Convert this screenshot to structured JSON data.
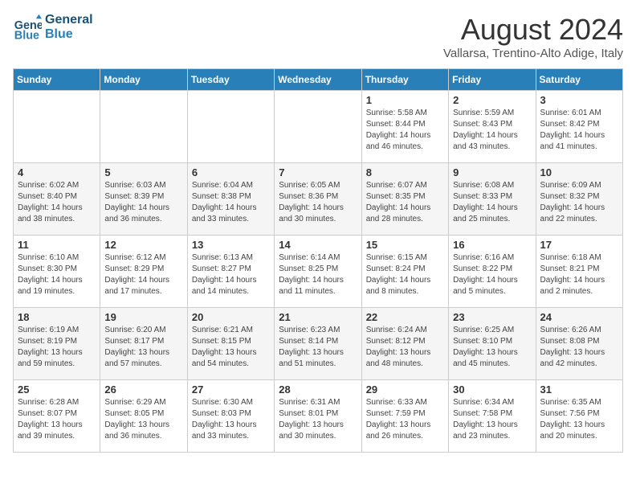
{
  "logo": {
    "line1": "General",
    "line2": "Blue"
  },
  "title": "August 2024",
  "location": "Vallarsa, Trentino-Alto Adige, Italy",
  "headers": [
    "Sunday",
    "Monday",
    "Tuesday",
    "Wednesday",
    "Thursday",
    "Friday",
    "Saturday"
  ],
  "weeks": [
    [
      {
        "day": "",
        "info": ""
      },
      {
        "day": "",
        "info": ""
      },
      {
        "day": "",
        "info": ""
      },
      {
        "day": "",
        "info": ""
      },
      {
        "day": "1",
        "info": "Sunrise: 5:58 AM\nSunset: 8:44 PM\nDaylight: 14 hours\nand 46 minutes."
      },
      {
        "day": "2",
        "info": "Sunrise: 5:59 AM\nSunset: 8:43 PM\nDaylight: 14 hours\nand 43 minutes."
      },
      {
        "day": "3",
        "info": "Sunrise: 6:01 AM\nSunset: 8:42 PM\nDaylight: 14 hours\nand 41 minutes."
      }
    ],
    [
      {
        "day": "4",
        "info": "Sunrise: 6:02 AM\nSunset: 8:40 PM\nDaylight: 14 hours\nand 38 minutes."
      },
      {
        "day": "5",
        "info": "Sunrise: 6:03 AM\nSunset: 8:39 PM\nDaylight: 14 hours\nand 36 minutes."
      },
      {
        "day": "6",
        "info": "Sunrise: 6:04 AM\nSunset: 8:38 PM\nDaylight: 14 hours\nand 33 minutes."
      },
      {
        "day": "7",
        "info": "Sunrise: 6:05 AM\nSunset: 8:36 PM\nDaylight: 14 hours\nand 30 minutes."
      },
      {
        "day": "8",
        "info": "Sunrise: 6:07 AM\nSunset: 8:35 PM\nDaylight: 14 hours\nand 28 minutes."
      },
      {
        "day": "9",
        "info": "Sunrise: 6:08 AM\nSunset: 8:33 PM\nDaylight: 14 hours\nand 25 minutes."
      },
      {
        "day": "10",
        "info": "Sunrise: 6:09 AM\nSunset: 8:32 PM\nDaylight: 14 hours\nand 22 minutes."
      }
    ],
    [
      {
        "day": "11",
        "info": "Sunrise: 6:10 AM\nSunset: 8:30 PM\nDaylight: 14 hours\nand 19 minutes."
      },
      {
        "day": "12",
        "info": "Sunrise: 6:12 AM\nSunset: 8:29 PM\nDaylight: 14 hours\nand 17 minutes."
      },
      {
        "day": "13",
        "info": "Sunrise: 6:13 AM\nSunset: 8:27 PM\nDaylight: 14 hours\nand 14 minutes."
      },
      {
        "day": "14",
        "info": "Sunrise: 6:14 AM\nSunset: 8:25 PM\nDaylight: 14 hours\nand 11 minutes."
      },
      {
        "day": "15",
        "info": "Sunrise: 6:15 AM\nSunset: 8:24 PM\nDaylight: 14 hours\nand 8 minutes."
      },
      {
        "day": "16",
        "info": "Sunrise: 6:16 AM\nSunset: 8:22 PM\nDaylight: 14 hours\nand 5 minutes."
      },
      {
        "day": "17",
        "info": "Sunrise: 6:18 AM\nSunset: 8:21 PM\nDaylight: 14 hours\nand 2 minutes."
      }
    ],
    [
      {
        "day": "18",
        "info": "Sunrise: 6:19 AM\nSunset: 8:19 PM\nDaylight: 13 hours\nand 59 minutes."
      },
      {
        "day": "19",
        "info": "Sunrise: 6:20 AM\nSunset: 8:17 PM\nDaylight: 13 hours\nand 57 minutes."
      },
      {
        "day": "20",
        "info": "Sunrise: 6:21 AM\nSunset: 8:15 PM\nDaylight: 13 hours\nand 54 minutes."
      },
      {
        "day": "21",
        "info": "Sunrise: 6:23 AM\nSunset: 8:14 PM\nDaylight: 13 hours\nand 51 minutes."
      },
      {
        "day": "22",
        "info": "Sunrise: 6:24 AM\nSunset: 8:12 PM\nDaylight: 13 hours\nand 48 minutes."
      },
      {
        "day": "23",
        "info": "Sunrise: 6:25 AM\nSunset: 8:10 PM\nDaylight: 13 hours\nand 45 minutes."
      },
      {
        "day": "24",
        "info": "Sunrise: 6:26 AM\nSunset: 8:08 PM\nDaylight: 13 hours\nand 42 minutes."
      }
    ],
    [
      {
        "day": "25",
        "info": "Sunrise: 6:28 AM\nSunset: 8:07 PM\nDaylight: 13 hours\nand 39 minutes."
      },
      {
        "day": "26",
        "info": "Sunrise: 6:29 AM\nSunset: 8:05 PM\nDaylight: 13 hours\nand 36 minutes."
      },
      {
        "day": "27",
        "info": "Sunrise: 6:30 AM\nSunset: 8:03 PM\nDaylight: 13 hours\nand 33 minutes."
      },
      {
        "day": "28",
        "info": "Sunrise: 6:31 AM\nSunset: 8:01 PM\nDaylight: 13 hours\nand 30 minutes."
      },
      {
        "day": "29",
        "info": "Sunrise: 6:33 AM\nSunset: 7:59 PM\nDaylight: 13 hours\nand 26 minutes."
      },
      {
        "day": "30",
        "info": "Sunrise: 6:34 AM\nSunset: 7:58 PM\nDaylight: 13 hours\nand 23 minutes."
      },
      {
        "day": "31",
        "info": "Sunrise: 6:35 AM\nSunset: 7:56 PM\nDaylight: 13 hours\nand 20 minutes."
      }
    ]
  ]
}
